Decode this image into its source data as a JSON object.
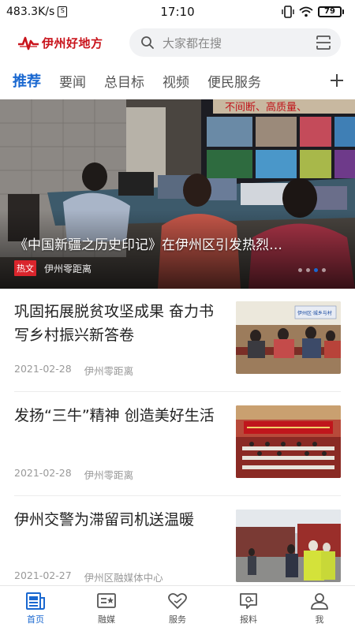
{
  "status_bar": {
    "speed": "483.3K/s",
    "time": "17:10",
    "battery": "79"
  },
  "header": {
    "logo_text": "伊州好地方",
    "search_placeholder": "大家都在搜"
  },
  "tabs": [
    {
      "label": "推荐",
      "active": true
    },
    {
      "label": "要闻",
      "active": false
    },
    {
      "label": "总目标",
      "active": false
    },
    {
      "label": "视频",
      "active": false
    },
    {
      "label": "便民服务",
      "active": false
    }
  ],
  "hero": {
    "title": "《中国新疆之历史印记》在伊州区引发热烈…",
    "badge": "热文",
    "source": "伊州零距离",
    "slides": 4,
    "active_slide": 3,
    "banner_text": "不间断、高质量、"
  },
  "news": [
    {
      "title": "巩固拓展脱贫攻坚成果 奋力书写乡村振兴新答卷",
      "date": "2021-02-28",
      "source": "伊州零距离",
      "thumb_text": "伊州区·城乡与村"
    },
    {
      "title": "发扬“三牛”精神 创造美好生活",
      "date": "2021-02-28",
      "source": "伊州零距离"
    },
    {
      "title": "伊州交警为滞留司机送温暖",
      "date": "2021-02-27",
      "source": "伊州区融媒体中心"
    }
  ],
  "bottom_nav": [
    {
      "label": "首页",
      "icon": "home-news-icon",
      "active": true
    },
    {
      "label": "融媒",
      "icon": "media-icon",
      "active": false
    },
    {
      "label": "服务",
      "icon": "heart-service-icon",
      "active": false
    },
    {
      "label": "报料",
      "icon": "report-icon",
      "active": false
    },
    {
      "label": "我",
      "icon": "user-icon",
      "active": false
    }
  ],
  "colors": {
    "accent": "#1a68d0",
    "brand_red": "#c9141c",
    "badge_red": "#d9252c"
  }
}
